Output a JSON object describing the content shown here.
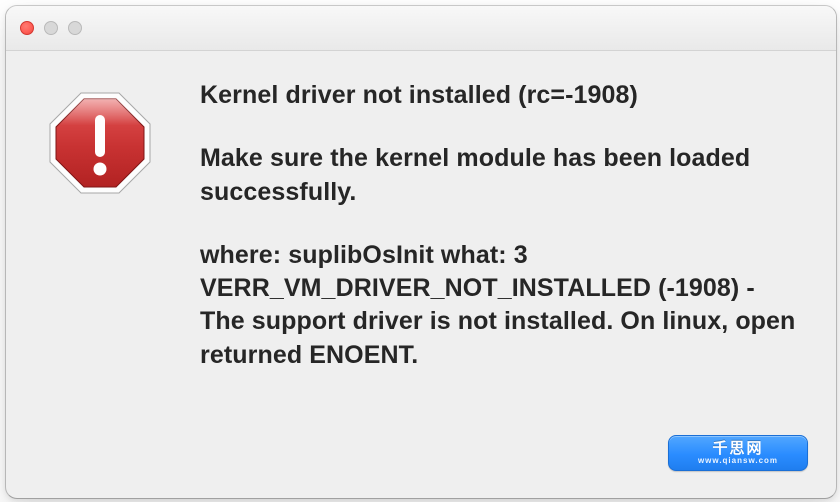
{
  "titlebar": {
    "close_name": "close",
    "min_name": "minimize",
    "zoom_name": "zoom"
  },
  "icon": {
    "name": "stop-sign-alert-icon"
  },
  "message": {
    "p1": "Kernel driver not installed (rc=-1908)",
    "p2": "Make sure the kernel module has been loaded successfully.",
    "p3": "where: suplibOsInit what: 3 VERR_VM_DRIVER_NOT_INSTALLED (-1908) - The support driver is not installed. On linux, open returned ENOENT."
  },
  "action": {
    "line1": "千思网",
    "line2": "www.qiansw.com"
  }
}
